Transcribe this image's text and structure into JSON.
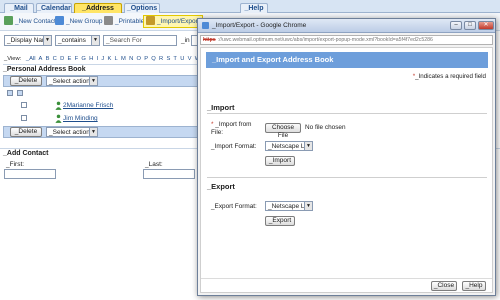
{
  "tabs": [
    {
      "label": "_Mail"
    },
    {
      "label": "_Calendar"
    },
    {
      "label": "_Address Book"
    },
    {
      "label": "_Options"
    },
    {
      "label": "_Help"
    }
  ],
  "toolbar": {
    "new_contact": "_New Contact",
    "new_group": "_New Group",
    "printable": "_Printable",
    "import_export": "_Import/Export"
  },
  "search": {
    "display_select": "_Display Name",
    "match_select": "_contains",
    "search_placeholder": "_Search For",
    "in_label": "_in"
  },
  "alpha": {
    "label": "_View:",
    "letters": [
      "_All",
      "A",
      "B",
      "C",
      "D",
      "E",
      "F",
      "G",
      "H",
      "I",
      "J",
      "K",
      "L",
      "M",
      "N",
      "O",
      "P",
      "Q",
      "R",
      "S",
      "T",
      "U",
      "V",
      "W",
      "X",
      "Y",
      "Z"
    ]
  },
  "address_book": {
    "title": "_Personal Address Book",
    "delete_label": "_Delete",
    "select_action": "_Select action",
    "contacts": [
      {
        "name": "2Marianne Frisch"
      },
      {
        "name": "Jim Minding"
      }
    ]
  },
  "add_contact": {
    "title": "_Add Contact",
    "first_label": "_First:",
    "last_label": "_Last:"
  },
  "popup": {
    "window_title": "_Import/Export - Google Chrome",
    "url_insecure": "https",
    "url_rest": "://uwc.webmail.optimum.net/uwc/abs/import/export-popup-mode.xml?bookId=a5f4f7ed2c5286",
    "header": "_Import and Export Address Book",
    "required_note": "_Indicates a required field",
    "import_section": "_Import",
    "import_from_label": "_Import from File:",
    "choose_file": "Choose File",
    "no_file": "No file chosen",
    "import_format_label": "_Import Format:",
    "import_format_value": "_Netscape Ldif",
    "import_button": "_Import",
    "export_section": "_Export",
    "export_format_label": "_Export Format:",
    "export_format_value": "_Netscape Ldif",
    "export_button": "_Export",
    "close_button": "_Close",
    "help_button": "_Help",
    "minimize_glyph": "–",
    "maximize_glyph": "□",
    "close_glyph": "✕"
  },
  "colors": {
    "active_tab": "#ffe566",
    "header_blue": "#6d9edb",
    "bar_blue": "#c5d8f1",
    "link_blue": "#1f4e8c",
    "required_red": "#c0392b"
  }
}
